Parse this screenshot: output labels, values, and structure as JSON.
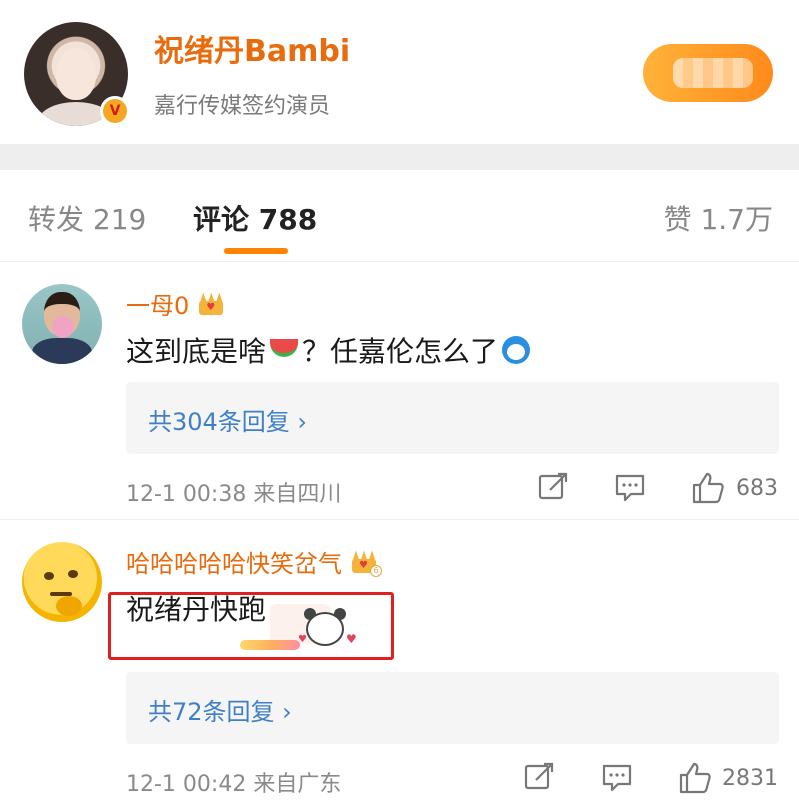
{
  "author": {
    "name": "祝绪丹Bambi",
    "description": "嘉行传媒签约演员",
    "verified_badge": "V"
  },
  "tabs": {
    "repost": "转发 219",
    "comment": "评论 788",
    "like": "赞 1.7万"
  },
  "comments": [
    {
      "username": "一母0",
      "text": "这到底是啥",
      "text_after_emoji": "？任嘉伦怎么了",
      "replies": "共304条回复 ›",
      "time_location": "12-1 00:38  来自四川",
      "likes": "683"
    },
    {
      "username": "哈哈哈哈哈快笑岔气",
      "text": "祝绪丹快跑",
      "replies": "共72条回复 ›",
      "time_location": "12-1 00:42  来自广东",
      "likes": "2831",
      "badge_level": "6"
    }
  ],
  "colors": {
    "accent": "#ff8200",
    "username": "#e86b0d",
    "link": "#3f7fc7",
    "highlight": "#e21f1f"
  },
  "icons": [
    "verified-icon",
    "crown-icon",
    "watermelon-icon",
    "doraemon-icon",
    "share-icon",
    "comment-icon",
    "like-icon"
  ]
}
